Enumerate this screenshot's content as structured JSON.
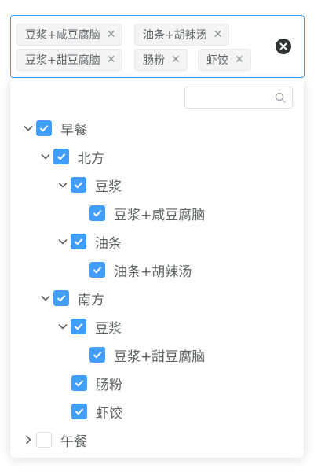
{
  "selected_tags": [
    {
      "label": "豆浆+咸豆腐脑"
    },
    {
      "label": "油条+胡辣汤"
    },
    {
      "label": "豆浆+甜豆腐脑"
    },
    {
      "label": "肠粉"
    },
    {
      "label": "虾饺"
    }
  ],
  "search": {
    "placeholder": "",
    "value": ""
  },
  "tree": [
    {
      "label": "早餐",
      "expanded": true,
      "checked": true
    },
    {
      "label": "北方",
      "expanded": true,
      "checked": true
    },
    {
      "label": "豆浆",
      "expanded": true,
      "checked": true
    },
    {
      "label": "豆浆+咸豆腐脑",
      "checked": true
    },
    {
      "label": "油条",
      "expanded": true,
      "checked": true
    },
    {
      "label": "油条+胡辣汤",
      "checked": true
    },
    {
      "label": "南方",
      "expanded": true,
      "checked": true
    },
    {
      "label": "豆浆",
      "expanded": true,
      "checked": true
    },
    {
      "label": "豆浆+甜豆腐脑",
      "checked": true
    },
    {
      "label": "肠粉",
      "checked": true
    },
    {
      "label": "虾饺",
      "checked": true
    },
    {
      "label": "午餐",
      "expanded": false,
      "checked": false
    }
  ],
  "colors": {
    "accent": "#409eff",
    "text": "#606266",
    "tag_bg": "#f4f4f5",
    "clear_icon": "#303133"
  },
  "icons": {
    "tag_close": "close-icon",
    "clear": "circle-close-icon",
    "search": "search-icon",
    "expanded": "chevron-down-icon",
    "collapsed": "chevron-right-icon",
    "check": "check-icon"
  }
}
